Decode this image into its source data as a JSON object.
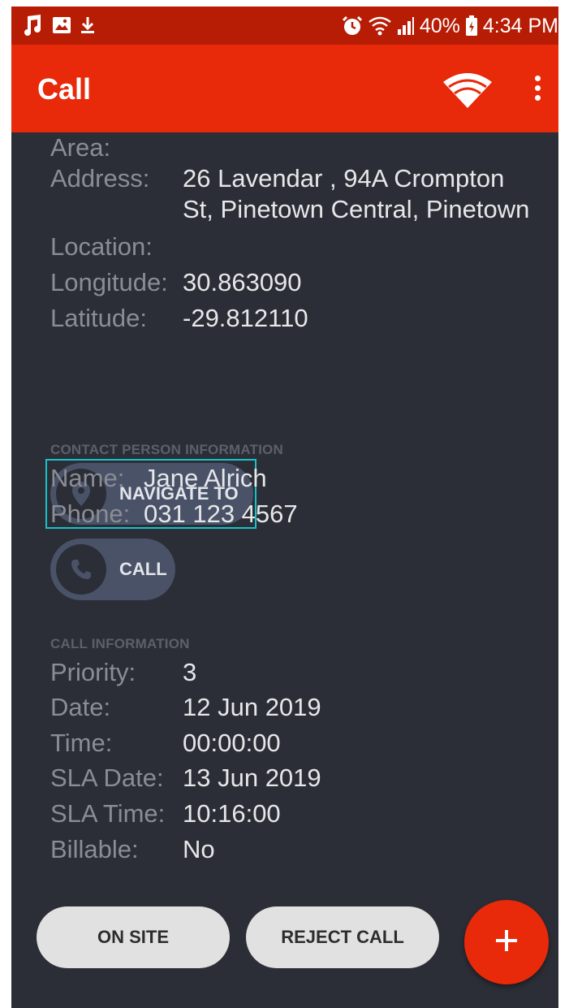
{
  "status_bar": {
    "battery": "40%",
    "time": "4:34 PM",
    "icons": [
      "music-note-icon",
      "image-icon",
      "download-icon",
      "alarm-icon",
      "wifi-icon",
      "signal-icon",
      "battery-icon"
    ]
  },
  "app_bar": {
    "title": "Call",
    "icons": [
      "wifi-icon",
      "overflow-menu-icon"
    ]
  },
  "address_info": {
    "area_label": "Area:",
    "address_label": "Address:",
    "address_line1": "26 Lavendar , 94A Crompton",
    "address_line2": "St, Pinetown Central, Pinetown",
    "location_label": "Location:",
    "longitude_label": "Longitude:",
    "longitude_value": "30.863090",
    "latitude_label": "Latitude:",
    "latitude_value": "-29.812110",
    "navigate_label": "NAVIGATE TO"
  },
  "contact_info": {
    "heading": "CONTACT PERSON INFORMATION",
    "name_label": "Name:",
    "name_value": "Jane Alrich",
    "phone_label": "Phone:",
    "phone_value": "031 123 4567",
    "call_label": "CALL"
  },
  "call_info": {
    "heading": "CALL INFORMATION",
    "priority_label": "Priority:",
    "priority_value": "3",
    "date_label": "Date:",
    "date_value": "12 Jun 2019",
    "time_label": "Time:",
    "time_value": "00:00:00",
    "sla_date_label": "SLA Date:",
    "sla_date_value": "13 Jun 2019",
    "sla_time_label": "SLA Time:",
    "sla_time_value": "10:16:00",
    "billable_label": "Billable:",
    "billable_value": "No"
  },
  "actions": {
    "on_site_label": "ON SITE",
    "reject_label": "REJECT CALL",
    "fab_icon": "plus-icon"
  },
  "colors": {
    "status_bar": "#b71c05",
    "app_bar": "#e8290a",
    "background": "#2b2e36",
    "highlight": "#19c2c9"
  }
}
